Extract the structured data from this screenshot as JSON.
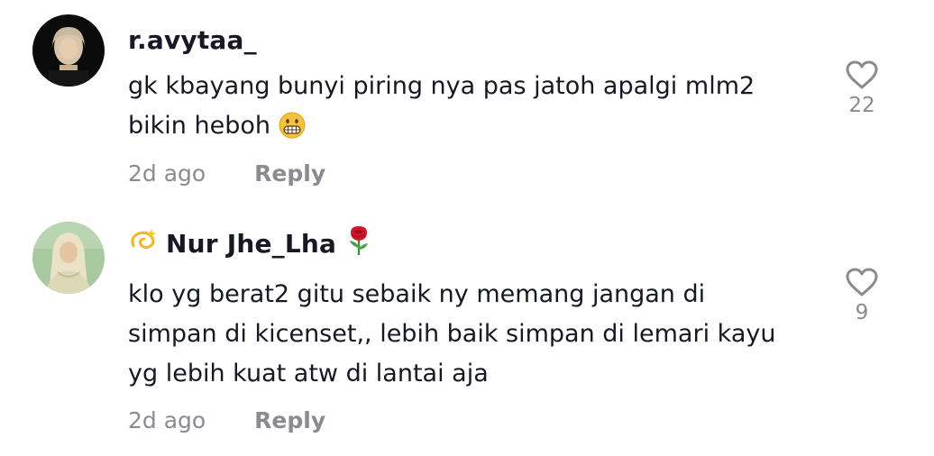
{
  "comments": [
    {
      "username": "r.avytaa_",
      "lines": [
        "gk kbayang bunyi piring nya pas jatoh apalgi mlm2",
        "bikin heboh"
      ],
      "trailing_emoji": "grimacing-face-emoji",
      "time": "2d ago",
      "reply_label": "Reply",
      "like_count": "22",
      "like_icon": "heart-outline-icon"
    },
    {
      "username": "Nur Jhe_Lha",
      "name_prefix_emoji": "dizzy-emoji",
      "name_suffix_emoji": "rose-emoji",
      "lines": [
        "klo yg berat2 gitu sebaik ny memang jangan di",
        "simpan di kicenset,, lebih baik simpan di lemari kayu",
        "yg lebih kuat atw di lantai aja"
      ],
      "time": "2d ago",
      "reply_label": "Reply",
      "like_count": "9",
      "like_icon": "heart-outline-icon"
    }
  ],
  "colors": {
    "text": "#161823",
    "muted": "#8a8b91",
    "background": "#ffffff"
  }
}
